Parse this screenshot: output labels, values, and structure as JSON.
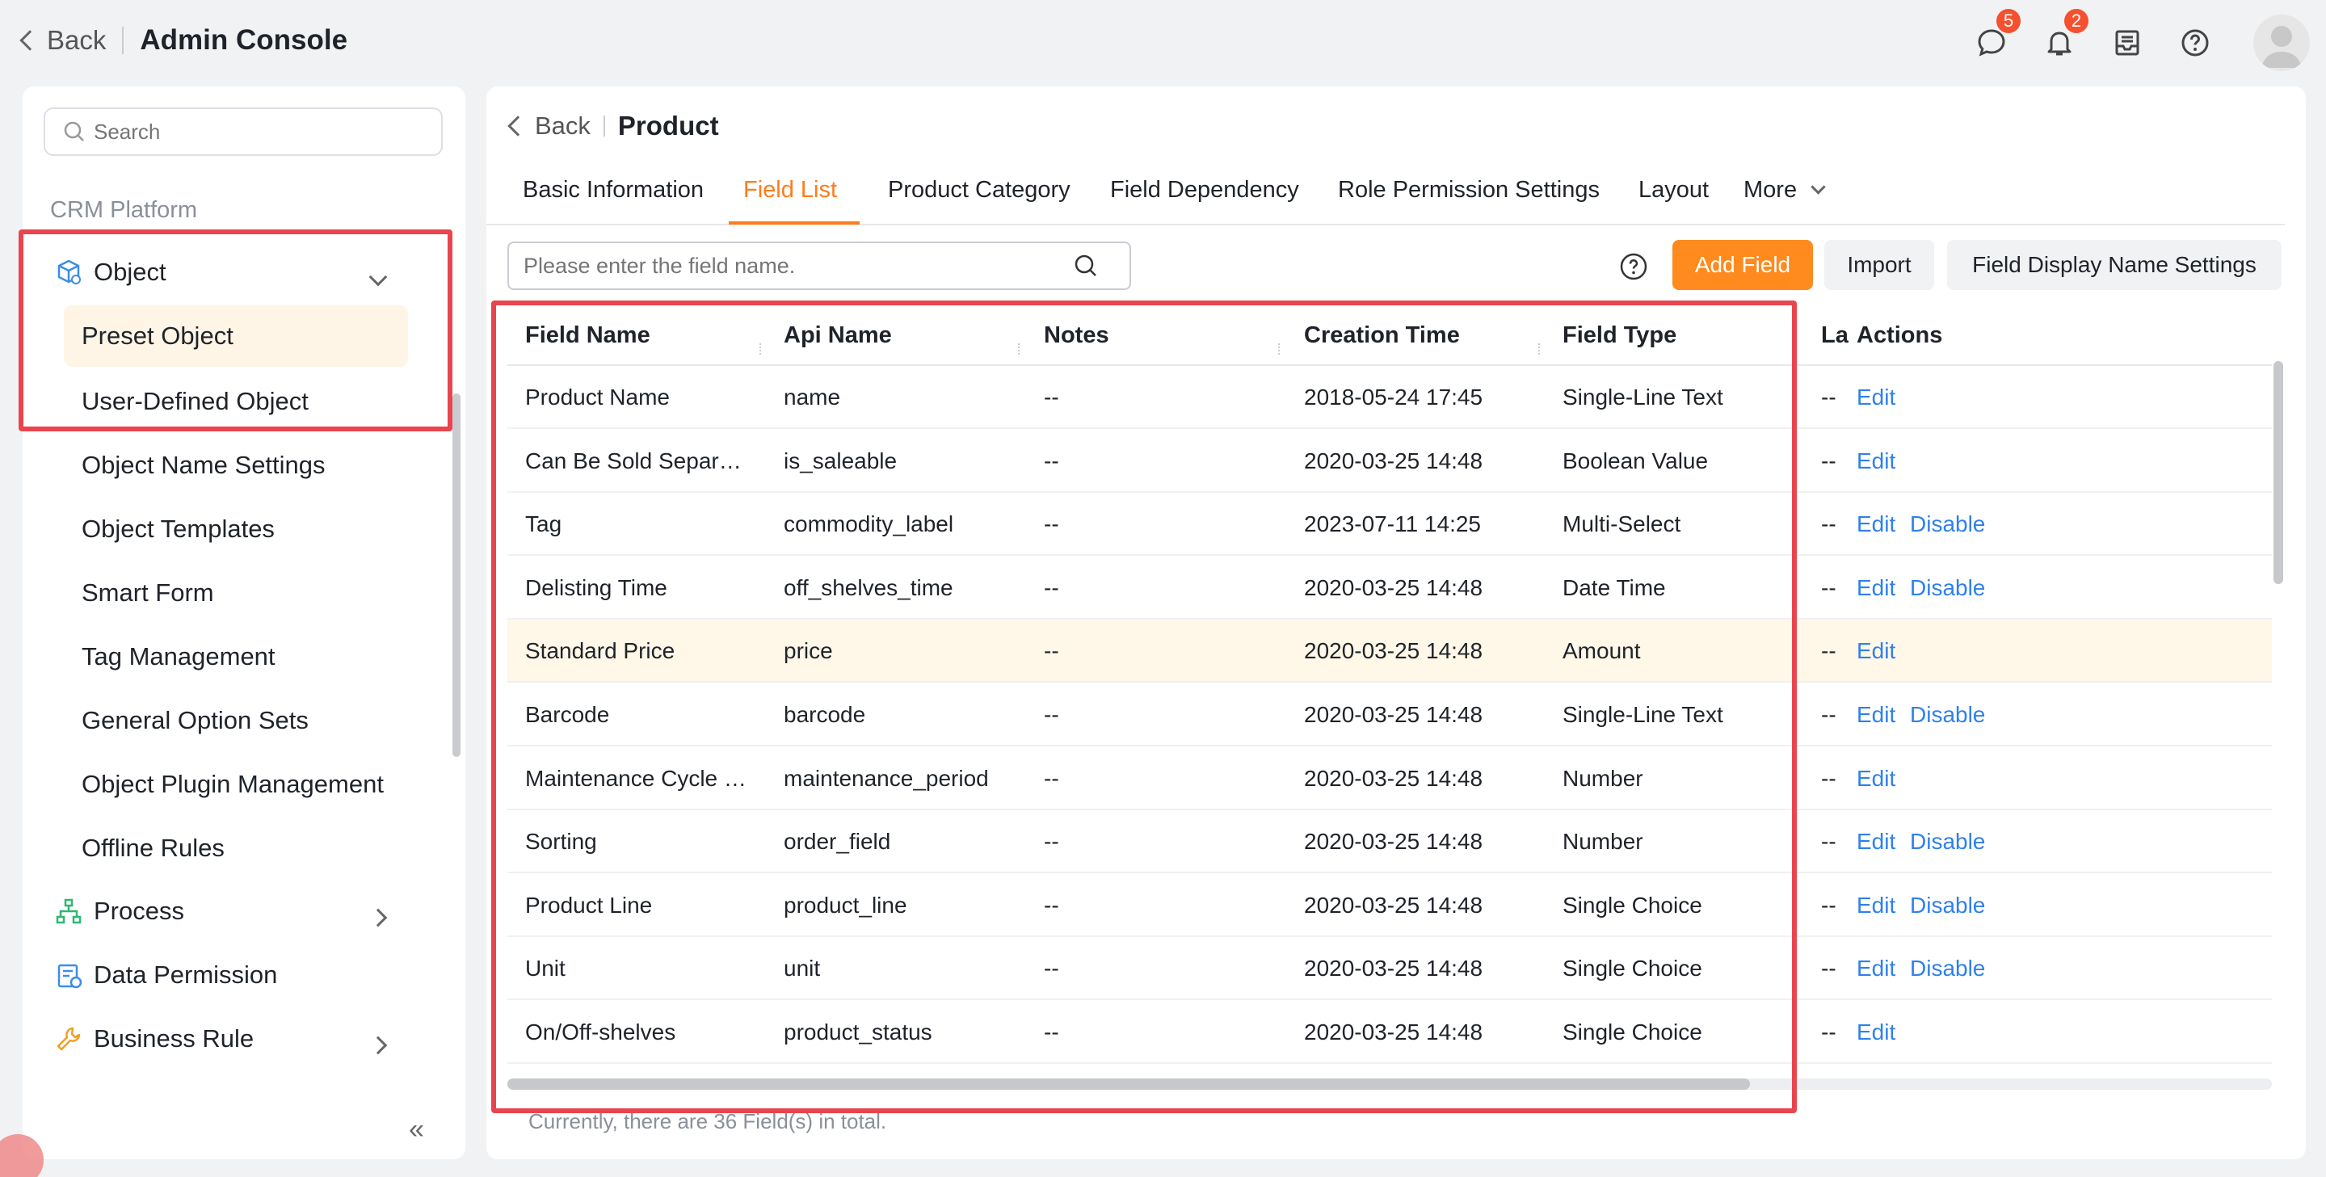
{
  "header": {
    "back_label": "Back",
    "app_title": "Admin Console",
    "messages_badge": "5",
    "notifications_badge": "2"
  },
  "sidebar": {
    "search_placeholder": "Search",
    "section_label": "CRM Platform",
    "object_label": "Object",
    "object_children": [
      "Preset Object",
      "User-Defined Object"
    ],
    "object_tools": [
      "Object Name Settings",
      "Object Templates",
      "Smart Form",
      "Tag Management",
      "General Option Sets",
      "Object Plugin Management",
      "Offline Rules"
    ],
    "process_label": "Process",
    "data_permission_label": "Data Permission",
    "business_rule_label": "Business Rule"
  },
  "main": {
    "back_label": "Back",
    "page_title": "Product",
    "tabs": [
      "Basic Information",
      "Field List",
      "Product Category",
      "Field Dependency",
      "Role Permission Settings",
      "Layout",
      "More"
    ],
    "active_tab": "Field List",
    "field_search_placeholder": "Please enter the field name.",
    "add_field_label": "Add Field",
    "import_label": "Import",
    "display_name_settings_label": "Field Display Name Settings",
    "columns": [
      "Field Name",
      "Api Name",
      "Notes",
      "Creation Time",
      "Field Type",
      "La",
      "Actions"
    ],
    "rows": [
      {
        "name": "Product Name",
        "api": "name",
        "notes": "--",
        "created": "2018-05-24 17:45",
        "type": "Single-Line Text",
        "la": "--",
        "edit": "Edit",
        "disable": ""
      },
      {
        "name": "Can Be Sold Separ…",
        "api": "is_saleable",
        "notes": "--",
        "created": "2020-03-25 14:48",
        "type": "Boolean Value",
        "la": "--",
        "edit": "Edit",
        "disable": ""
      },
      {
        "name": "Tag",
        "api": "commodity_label",
        "notes": "--",
        "created": "2023-07-11 14:25",
        "type": "Multi-Select",
        "la": "--",
        "edit": "Edit",
        "disable": "Disable"
      },
      {
        "name": "Delisting Time",
        "api": "off_shelves_time",
        "notes": "--",
        "created": "2020-03-25 14:48",
        "type": "Date Time",
        "la": "--",
        "edit": "Edit",
        "disable": "Disable"
      },
      {
        "name": "Standard Price",
        "api": "price",
        "notes": "--",
        "created": "2020-03-25 14:48",
        "type": "Amount",
        "la": "--",
        "edit": "Edit",
        "disable": ""
      },
      {
        "name": "Barcode",
        "api": "barcode",
        "notes": "--",
        "created": "2020-03-25 14:48",
        "type": "Single-Line Text",
        "la": "--",
        "edit": "Edit",
        "disable": "Disable"
      },
      {
        "name": "Maintenance Cycle …",
        "api": "maintenance_period",
        "notes": "--",
        "created": "2020-03-25 14:48",
        "type": "Number",
        "la": "--",
        "edit": "Edit",
        "disable": ""
      },
      {
        "name": "Sorting",
        "api": "order_field",
        "notes": "--",
        "created": "2020-03-25 14:48",
        "type": "Number",
        "la": "--",
        "edit": "Edit",
        "disable": "Disable"
      },
      {
        "name": "Product Line",
        "api": "product_line",
        "notes": "--",
        "created": "2020-03-25 14:48",
        "type": "Single Choice",
        "la": "--",
        "edit": "Edit",
        "disable": "Disable"
      },
      {
        "name": "Unit",
        "api": "unit",
        "notes": "--",
        "created": "2020-03-25 14:48",
        "type": "Single Choice",
        "la": "--",
        "edit": "Edit",
        "disable": "Disable"
      },
      {
        "name": "On/Off-shelves",
        "api": "product_status",
        "notes": "--",
        "created": "2020-03-25 14:48",
        "type": "Single Choice",
        "la": "--",
        "edit": "Edit",
        "disable": ""
      }
    ],
    "footer_count": "Currently, there are 36 Field(s) in total."
  },
  "colors": {
    "accent": "#ff8a1e",
    "link": "#2f80ed",
    "highlight_row": "#fff8e8",
    "annotation_box": "#e8454f"
  },
  "icons": [
    "chevron-left-icon",
    "message-icon",
    "bell-icon",
    "inbox-icon",
    "help-icon",
    "search-icon",
    "object-icon",
    "process-icon",
    "data-permission-icon",
    "business-rule-icon",
    "collapse-icon"
  ]
}
